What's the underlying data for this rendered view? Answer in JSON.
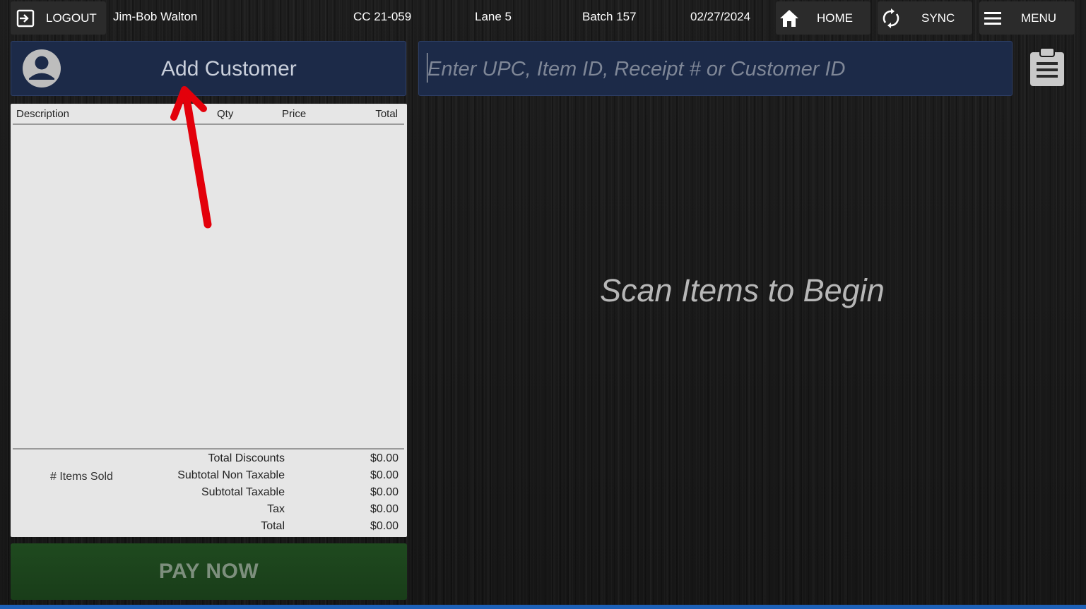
{
  "topbar": {
    "logout_label": "LOGOUT",
    "user_name": "Jim-Bob Walton",
    "terminal": "CC 21-059",
    "lane": "Lane 5",
    "batch": "Batch 157",
    "date": "02/27/2024",
    "home_label": "HOME",
    "sync_label": "SYNC",
    "menu_label": "MENU"
  },
  "customer": {
    "label": "Add Customer"
  },
  "search": {
    "placeholder": "Enter UPC, Item ID, Receipt # or Customer ID",
    "value": ""
  },
  "receipt": {
    "columns": [
      "Description",
      "Qty",
      "Price",
      "Total"
    ],
    "rows": [],
    "items_sold_label": "# Items Sold",
    "summary": [
      {
        "label": "Total Discounts",
        "value": "$0.00"
      },
      {
        "label": "Subtotal Non Taxable",
        "value": "$0.00"
      },
      {
        "label": "Subtotal Taxable",
        "value": "$0.00"
      },
      {
        "label": "Tax",
        "value": "$0.00"
      },
      {
        "label": "Total",
        "value": "$0.00"
      }
    ]
  },
  "pay_now_label": "PAY NOW",
  "scan_message": "Scan Items to Begin",
  "colors": {
    "panel_blue": "#1c2a48",
    "pay_green": "#1f4a1f",
    "annotation_red": "#e3000b",
    "status_strip": "#1d61b8"
  }
}
